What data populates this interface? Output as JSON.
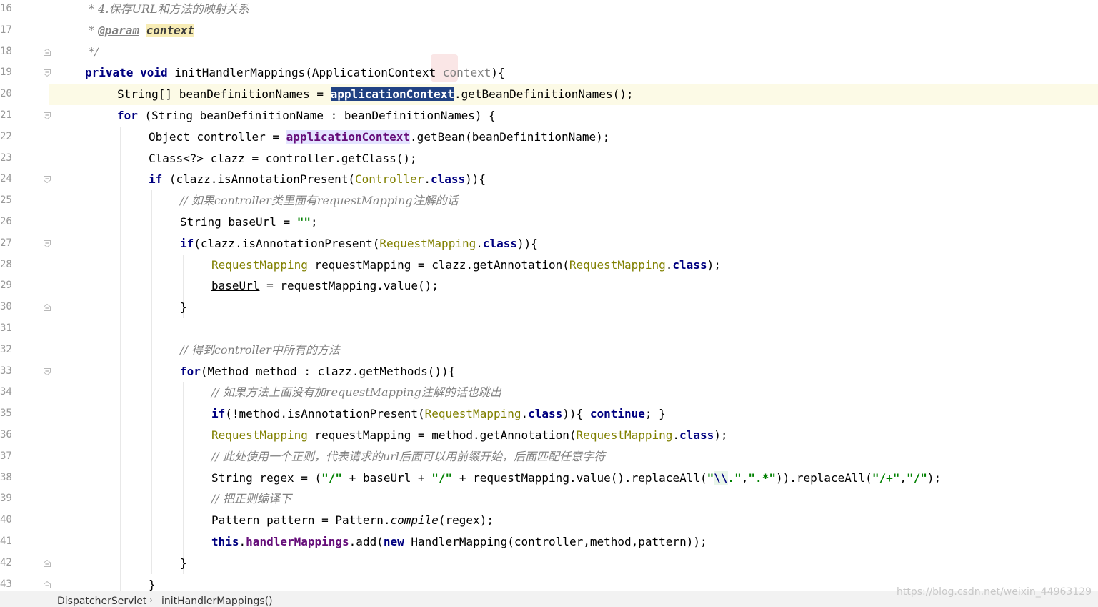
{
  "editor": {
    "lines": [
      {
        "num": "16",
        "indent": 1,
        "tokens": [
          {
            "t": " * 4.保存URL和方法的映射关系",
            "c": "cm"
          }
        ]
      },
      {
        "num": "17",
        "indent": 1,
        "tokens": [
          {
            "t": " * ",
            "c": "cm"
          },
          {
            "t": "@param",
            "c": "doctag"
          },
          {
            "t": " ",
            "c": ""
          },
          {
            "t": "context",
            "c": "docparam"
          }
        ]
      },
      {
        "num": "18",
        "indent": 1,
        "tokens": [
          {
            "t": " */",
            "c": "cm"
          }
        ]
      },
      {
        "num": "19",
        "indent": 1,
        "tokens": [
          {
            "t": "private void",
            "c": "kw"
          },
          {
            "t": " initHandlerMappings(ApplicationContext ",
            "c": ""
          },
          {
            "t": "context",
            "c": "unused"
          },
          {
            "t": "){",
            "c": ""
          }
        ]
      },
      {
        "num": "20",
        "indent": 2,
        "current": true,
        "tokens": [
          {
            "t": "String[] beanDefinitionNames = ",
            "c": ""
          },
          {
            "t": "applicationContext",
            "c": "sel"
          },
          {
            "t": ".getBeanDefinitionNames();",
            "c": ""
          }
        ]
      },
      {
        "num": "21",
        "indent": 2,
        "tokens": [
          {
            "t": "for",
            "c": "kw"
          },
          {
            "t": " (String beanDefinitionName : beanDefinitionNames) {",
            "c": ""
          }
        ]
      },
      {
        "num": "22",
        "indent": 3,
        "tokens": [
          {
            "t": "Object controller = ",
            "c": ""
          },
          {
            "t": "applicationContext",
            "c": "ident-hl"
          },
          {
            "t": ".getBean(beanDefinitionName);",
            "c": ""
          }
        ]
      },
      {
        "num": "23",
        "indent": 3,
        "tokens": [
          {
            "t": "Class<?> clazz = controller.getClass();",
            "c": ""
          }
        ]
      },
      {
        "num": "24",
        "indent": 3,
        "tokens": [
          {
            "t": "if",
            "c": "kw"
          },
          {
            "t": " (clazz.isAnnotationPresent(",
            "c": ""
          },
          {
            "t": "Controller",
            "c": "cls"
          },
          {
            "t": ".",
            "c": ""
          },
          {
            "t": "class",
            "c": "kw"
          },
          {
            "t": ")){",
            "c": ""
          }
        ]
      },
      {
        "num": "25",
        "indent": 4,
        "tokens": [
          {
            "t": "// 如果controller类里面有requestMapping注解的话",
            "c": "cm"
          }
        ]
      },
      {
        "num": "26",
        "indent": 4,
        "tokens": [
          {
            "t": "String ",
            "c": ""
          },
          {
            "t": "baseUrl",
            "c": "underl"
          },
          {
            "t": " = ",
            "c": ""
          },
          {
            "t": "\"\"",
            "c": "str"
          },
          {
            "t": ";",
            "c": ""
          }
        ]
      },
      {
        "num": "27",
        "indent": 4,
        "tokens": [
          {
            "t": "if",
            "c": "kw"
          },
          {
            "t": "(clazz.isAnnotationPresent(",
            "c": ""
          },
          {
            "t": "RequestMapping",
            "c": "cls"
          },
          {
            "t": ".",
            "c": ""
          },
          {
            "t": "class",
            "c": "kw"
          },
          {
            "t": ")){",
            "c": ""
          }
        ]
      },
      {
        "num": "28",
        "indent": 5,
        "tokens": [
          {
            "t": "RequestMapping",
            "c": "cls"
          },
          {
            "t": " requestMapping = clazz.getAnnotation(",
            "c": ""
          },
          {
            "t": "RequestMapping",
            "c": "cls"
          },
          {
            "t": ".",
            "c": ""
          },
          {
            "t": "class",
            "c": "kw"
          },
          {
            "t": ");",
            "c": ""
          }
        ]
      },
      {
        "num": "29",
        "indent": 5,
        "tokens": [
          {
            "t": "baseUrl",
            "c": "underl"
          },
          {
            "t": " = requestMapping.value();",
            "c": ""
          }
        ]
      },
      {
        "num": "30",
        "indent": 4,
        "tokens": [
          {
            "t": "}",
            "c": ""
          }
        ]
      },
      {
        "num": "31",
        "indent": 4,
        "tokens": []
      },
      {
        "num": "32",
        "indent": 4,
        "tokens": [
          {
            "t": "// 得到controller中所有的方法",
            "c": "cm"
          }
        ]
      },
      {
        "num": "33",
        "indent": 4,
        "tokens": [
          {
            "t": "for",
            "c": "kw"
          },
          {
            "t": "(Method method : clazz.getMethods()){",
            "c": ""
          }
        ]
      },
      {
        "num": "34",
        "indent": 5,
        "tokens": [
          {
            "t": "// 如果方法上面没有加requestMapping注解的话也跳出",
            "c": "cm"
          }
        ]
      },
      {
        "num": "35",
        "indent": 5,
        "tokens": [
          {
            "t": "if",
            "c": "kw"
          },
          {
            "t": "(!method.isAnnotationPresent(",
            "c": ""
          },
          {
            "t": "RequestMapping",
            "c": "cls"
          },
          {
            "t": ".",
            "c": ""
          },
          {
            "t": "class",
            "c": "kw"
          },
          {
            "t": ")){ ",
            "c": ""
          },
          {
            "t": "continue",
            "c": "kw"
          },
          {
            "t": "; }",
            "c": ""
          }
        ]
      },
      {
        "num": "36",
        "indent": 5,
        "tokens": [
          {
            "t": "RequestMapping",
            "c": "cls"
          },
          {
            "t": " requestMapping = method.getAnnotation(",
            "c": ""
          },
          {
            "t": "RequestMapping",
            "c": "cls"
          },
          {
            "t": ".",
            "c": ""
          },
          {
            "t": "class",
            "c": "kw"
          },
          {
            "t": ");",
            "c": ""
          }
        ]
      },
      {
        "num": "37",
        "indent": 5,
        "tokens": [
          {
            "t": "// 此处使用一个正则，代表请求的url后面可以用前缀开始，后面匹配任意字符",
            "c": "cm"
          }
        ]
      },
      {
        "num": "38",
        "indent": 5,
        "tokens": [
          {
            "t": "String regex = (",
            "c": ""
          },
          {
            "t": "\"/\"",
            "c": "str"
          },
          {
            "t": " + ",
            "c": ""
          },
          {
            "t": "baseUrl",
            "c": "underl"
          },
          {
            "t": " + ",
            "c": ""
          },
          {
            "t": "\"/\"",
            "c": "str"
          },
          {
            "t": " + requestMapping.value().replaceAll(",
            "c": ""
          },
          {
            "t": "\"",
            "c": "str"
          },
          {
            "t": "\\\\",
            "c": "escape"
          },
          {
            "t": ".\"",
            "c": "str"
          },
          {
            "t": ",",
            "c": ""
          },
          {
            "t": "\".*\"",
            "c": "str"
          },
          {
            "t": ")).replaceAll(",
            "c": ""
          },
          {
            "t": "\"/+\"",
            "c": "str"
          },
          {
            "t": ",",
            "c": ""
          },
          {
            "t": "\"/\"",
            "c": "str"
          },
          {
            "t": ");",
            "c": ""
          }
        ]
      },
      {
        "num": "39",
        "indent": 5,
        "tokens": [
          {
            "t": "// 把正则编译下",
            "c": "cm"
          }
        ]
      },
      {
        "num": "40",
        "indent": 5,
        "tokens": [
          {
            "t": "Pattern pattern = Pattern.",
            "c": ""
          },
          {
            "t": "compile",
            "c": "italic"
          },
          {
            "t": "(regex);",
            "c": ""
          }
        ]
      },
      {
        "num": "41",
        "indent": 5,
        "tokens": [
          {
            "t": "this",
            "c": "kw"
          },
          {
            "t": ".",
            "c": ""
          },
          {
            "t": "handlerMappings",
            "c": "field"
          },
          {
            "t": ".add(",
            "c": ""
          },
          {
            "t": "new",
            "c": "kw"
          },
          {
            "t": " HandlerMapping(controller,method,pattern));",
            "c": ""
          }
        ]
      },
      {
        "num": "42",
        "indent": 4,
        "tokens": [
          {
            "t": "}",
            "c": ""
          }
        ]
      },
      {
        "num": "43",
        "indent": 3,
        "tokens": [
          {
            "t": "}",
            "c": ""
          }
        ]
      }
    ]
  },
  "breadcrumb": {
    "class_name": "DispatcherServlet",
    "method_name": "initHandlerMappings()",
    "separator": "›"
  },
  "watermark": "https://blog.csdn.net/weixin_44963129"
}
